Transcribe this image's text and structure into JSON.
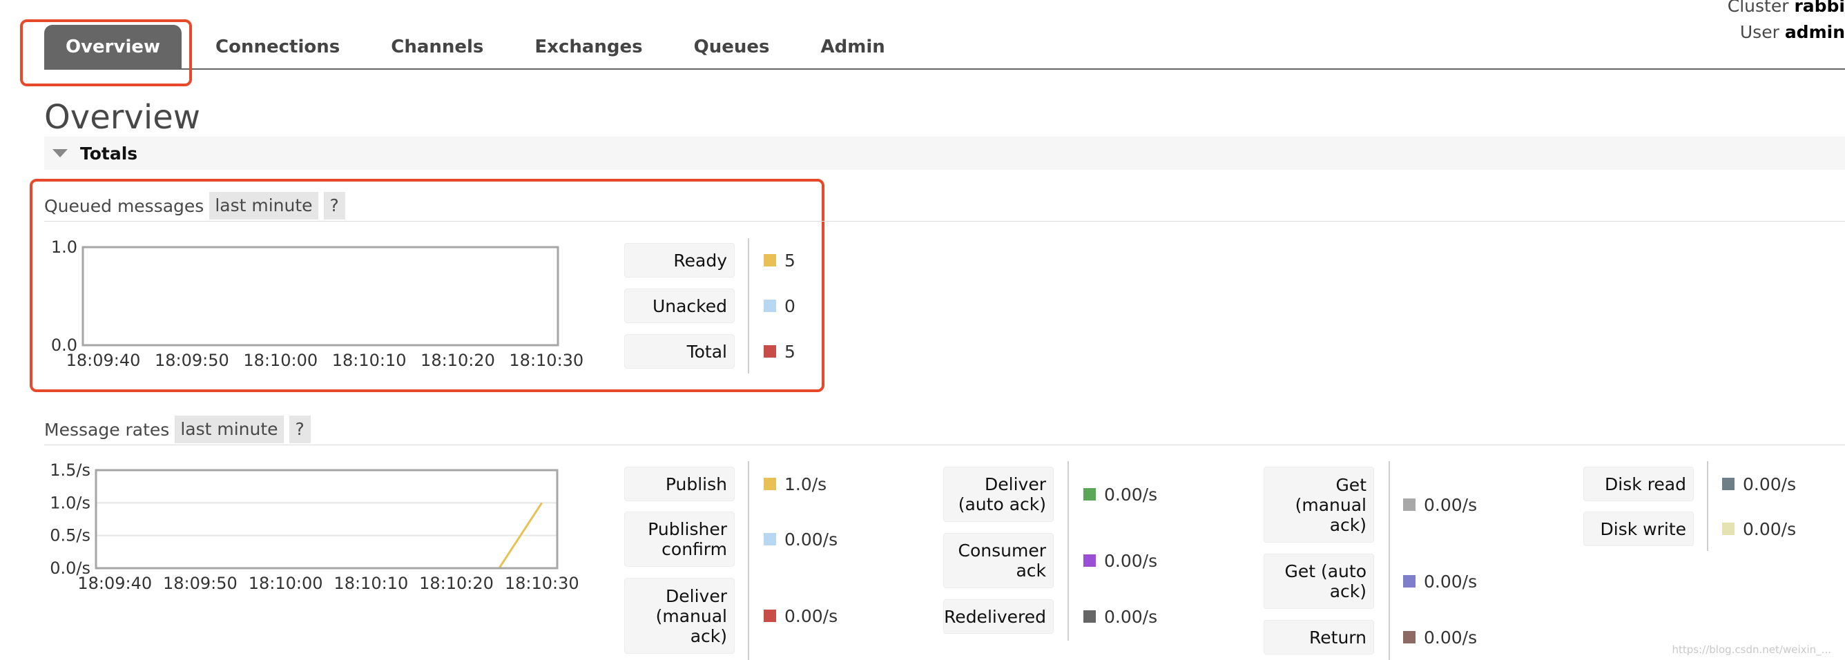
{
  "header": {
    "cluster_label": "Cluster",
    "cluster_name": "rabbi",
    "user_label": "User",
    "user_name": "admin"
  },
  "nav": {
    "tabs": [
      {
        "label": "Overview",
        "active": true
      },
      {
        "label": "Connections"
      },
      {
        "label": "Channels"
      },
      {
        "label": "Exchanges"
      },
      {
        "label": "Queues"
      },
      {
        "label": "Admin"
      }
    ]
  },
  "page": {
    "title": "Overview",
    "section_title": "Totals"
  },
  "queued": {
    "heading": "Queued messages",
    "range": "last minute",
    "help": "?",
    "legend": [
      {
        "label": "Ready",
        "value": "5",
        "color": "#e8c156"
      },
      {
        "label": "Unacked",
        "value": "0",
        "color": "#b8d7f2"
      },
      {
        "label": "Total",
        "value": "5",
        "color": "#c84c48"
      }
    ]
  },
  "rates": {
    "heading": "Message rates",
    "range": "last minute",
    "help": "?",
    "legend": [
      {
        "label": "Publish",
        "value": "1.0/s",
        "color": "#e8c156"
      },
      {
        "label": "Publisher confirm",
        "value": "0.00/s",
        "color": "#b8d7f2"
      },
      {
        "label": "Deliver (manual ack)",
        "value": "0.00/s",
        "color": "#c84c48"
      },
      {
        "label": "Deliver (auto ack)",
        "value": "0.00/s",
        "color": "#5aa757"
      },
      {
        "label": "Consumer ack",
        "value": "0.00/s",
        "color": "#9b4fd6"
      },
      {
        "label": "Redelivered",
        "value": "0.00/s",
        "color": "#666666"
      },
      {
        "label": "Get (manual ack)",
        "value": "0.00/s",
        "color": "#a8a8a8"
      },
      {
        "label": "Get (auto ack)",
        "value": "0.00/s",
        "color": "#7e7ecb"
      },
      {
        "label": "Return",
        "value": "0.00/s",
        "color": "#8e6a64"
      },
      {
        "label": "Disk read",
        "value": "0.00/s",
        "color": "#6e7f87"
      },
      {
        "label": "Disk write",
        "value": "0.00/s",
        "color": "#e6e3b2"
      }
    ]
  },
  "chart_data": [
    {
      "type": "line",
      "x": [
        "18:09:40",
        "18:09:50",
        "18:10:00",
        "18:10:10",
        "18:10:20",
        "18:10:30"
      ],
      "ylim": [
        0,
        1.0
      ],
      "yticks": [
        "0.0",
        "1.0"
      ],
      "series": [
        {
          "name": "Ready",
          "color": "#e8c156",
          "values": [
            0,
            0,
            0,
            0,
            0,
            0
          ]
        },
        {
          "name": "Total",
          "color": "#c84c48",
          "values": [
            0,
            0,
            0,
            0,
            0,
            0
          ]
        }
      ]
    },
    {
      "type": "line",
      "x": [
        "18:09:40",
        "18:09:50",
        "18:10:00",
        "18:10:10",
        "18:10:20",
        "18:10:30"
      ],
      "ylim": [
        0,
        1.5
      ],
      "yticks": [
        "0.0/s",
        "0.5/s",
        "1.0/s",
        "1.5/s"
      ],
      "series": [
        {
          "name": "Publish",
          "color": "#e8c156",
          "points": [
            [
              "18:09:40",
              0
            ],
            [
              "18:10:25",
              0
            ],
            [
              "18:10:30",
              1.0
            ]
          ]
        }
      ]
    }
  ],
  "footer": {
    "watermark": "https://blog.csdn.net/weixin_..."
  }
}
